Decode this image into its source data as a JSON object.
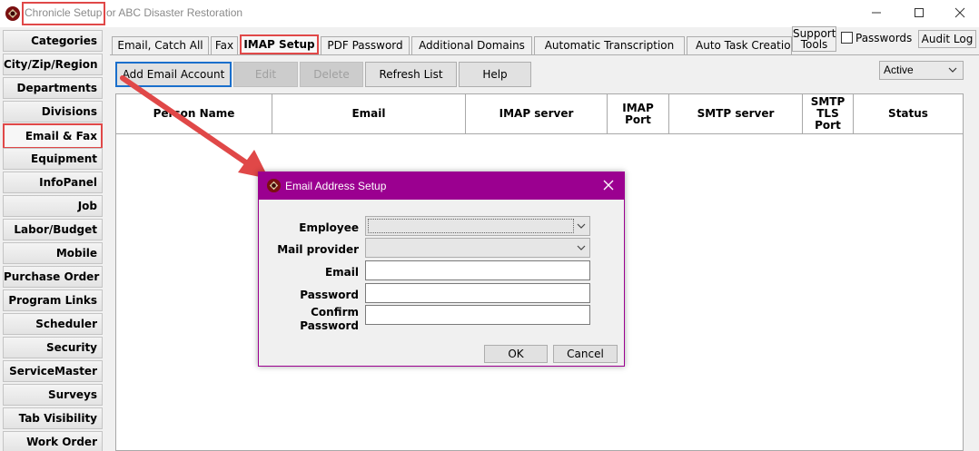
{
  "window": {
    "title_highlighted": "Chronicle Setup",
    "title_rest": "or ABC Disaster Restoration",
    "controls": [
      "minimize",
      "maximize",
      "close"
    ]
  },
  "categories": [
    "Categories",
    "City/Zip/Region",
    "Departments",
    "Divisions",
    "Email & Fax",
    "Equipment",
    "InfoPanel",
    "Job",
    "Labor/Budget",
    "Mobile",
    "Purchase Order",
    "Program Links",
    "Scheduler",
    "Security",
    "ServiceMaster",
    "Surveys",
    "Tab Visibility",
    "Work Order"
  ],
  "selected_category": "Email & Fax",
  "tabs": [
    "Email, Catch All",
    "Fax",
    "IMAP Setup",
    "PDF Password",
    "Additional Domains",
    "Automatic Transcription",
    "Auto Task Creation"
  ],
  "active_tab": "IMAP Setup",
  "top_right": {
    "support_tools_line1": "Support",
    "support_tools_line2": "Tools",
    "passwords_label": "Passwords",
    "passwords_checked": false,
    "audit_log": "Audit Log"
  },
  "toolbar": {
    "add_email_account": "Add Email Account",
    "edit": "Edit",
    "delete": "Delete",
    "refresh_list": "Refresh List",
    "help": "Help",
    "status_filter": "Active"
  },
  "grid": {
    "columns": {
      "person_name": "Person Name",
      "email": "Email",
      "imap_server": "IMAP server",
      "imap_port_1": "IMAP",
      "imap_port_2": "Port",
      "smtp_server": "SMTP server",
      "smtp_tls_port_1": "SMTP",
      "smtp_tls_port_2": "TLS",
      "smtp_tls_port_3": "Port",
      "status": "Status"
    },
    "rows": []
  },
  "dialog": {
    "title": "Email Address Setup",
    "labels": {
      "employee": "Employee",
      "mail_provider": "Mail provider",
      "email": "Email",
      "password": "Password",
      "confirm_1": "Confirm",
      "confirm_2": "Password"
    },
    "values": {
      "employee": "",
      "mail_provider": "",
      "email": "",
      "password": "",
      "confirm_password": ""
    },
    "ok": "OK",
    "cancel": "Cancel"
  },
  "colors": {
    "dialog_titlebar": "#9b0090",
    "highlight": "#e04848",
    "focus": "#1a6fcc"
  }
}
